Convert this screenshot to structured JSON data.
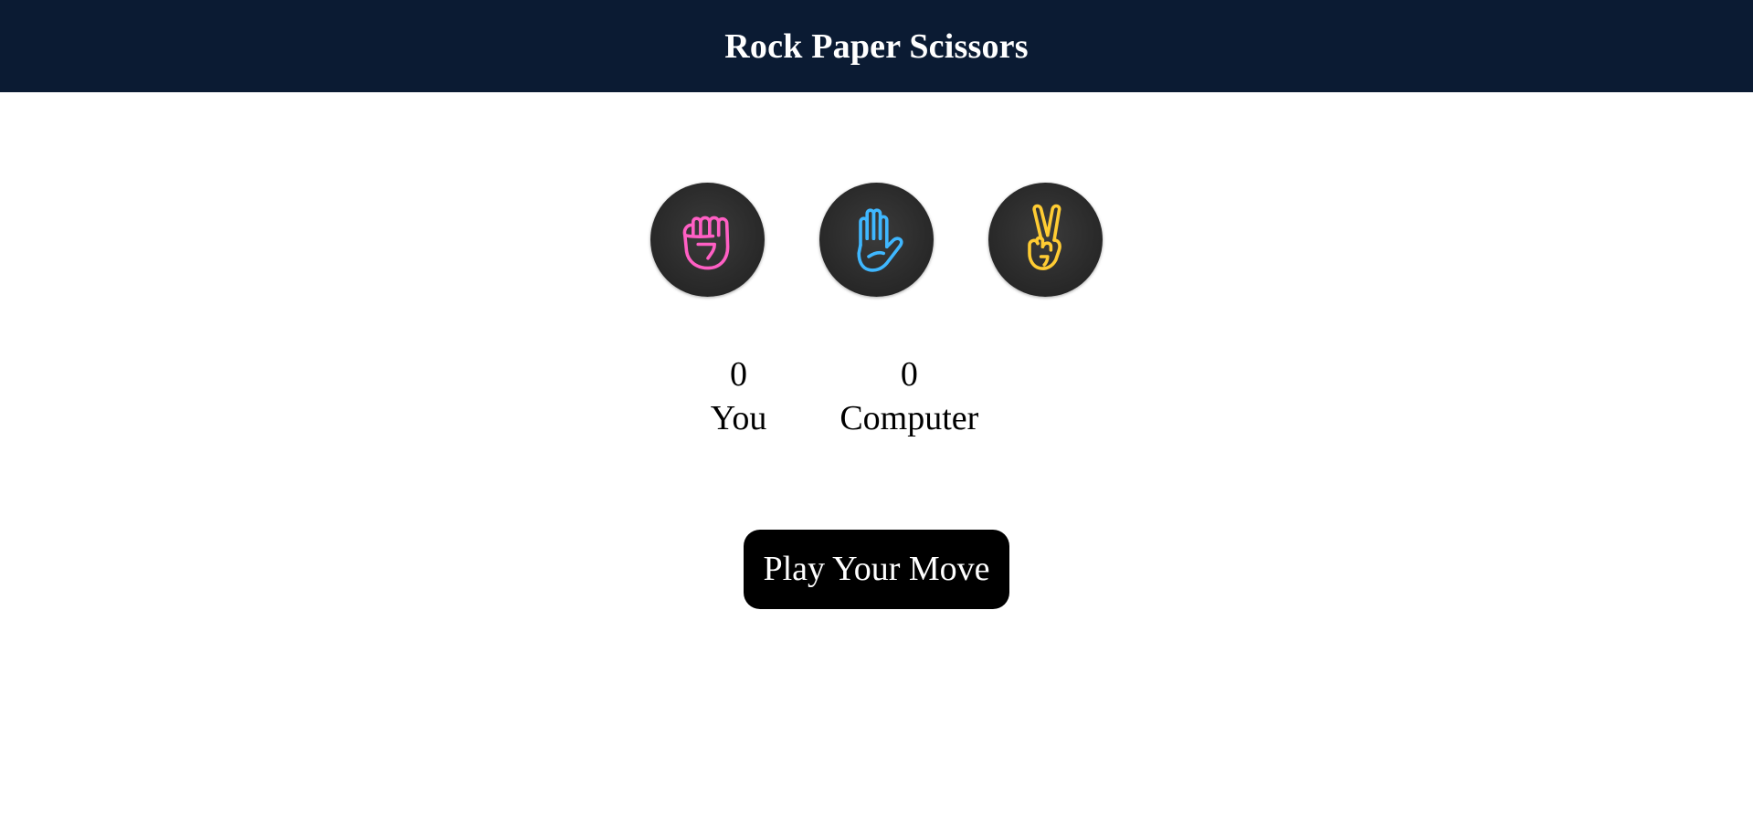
{
  "header": {
    "title": "Rock Paper Scissors",
    "background": "#0b1b33"
  },
  "choices": [
    {
      "id": "rock",
      "icon": "fist-icon",
      "color": "#ff5fc4"
    },
    {
      "id": "paper",
      "icon": "open-hand-icon",
      "color": "#3fb7ff"
    },
    {
      "id": "scissors",
      "icon": "peace-hand-icon",
      "color": "#ffcc33"
    }
  ],
  "scoreboard": {
    "user": {
      "score": "0",
      "label": "You"
    },
    "computer": {
      "score": "0",
      "label": "Computer"
    }
  },
  "message": {
    "text": "Play Your Move",
    "background": "#000000"
  }
}
